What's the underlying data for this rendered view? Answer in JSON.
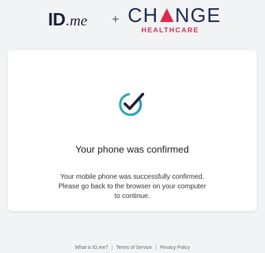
{
  "header": {
    "idme_logo": {
      "id": "ID",
      "me": ".me"
    },
    "plus": "+",
    "partner_logo": {
      "word_before": "CH",
      "word_after": "NGE",
      "subtitle": "HEALTHCARE",
      "accent_color": "#e0294f",
      "brand_color": "#1c2a4a"
    }
  },
  "card": {
    "icon": "checkmark-circle-icon",
    "title": "Your phone was confirmed",
    "message_lines": [
      "Your mobile phone was successfully confirmed.",
      "Please go back to the browser on your computer",
      "to continue."
    ]
  },
  "footer": {
    "links": [
      "What is ID.me?",
      "Terms of Service",
      "Privacy Policy"
    ],
    "separator": "|"
  },
  "colors": {
    "background": "#f2f3f5",
    "card": "#ffffff",
    "check_ring_start": "#27b6a6",
    "check_ring_end": "#2b8fd6",
    "check_mark": "#1a2238"
  }
}
